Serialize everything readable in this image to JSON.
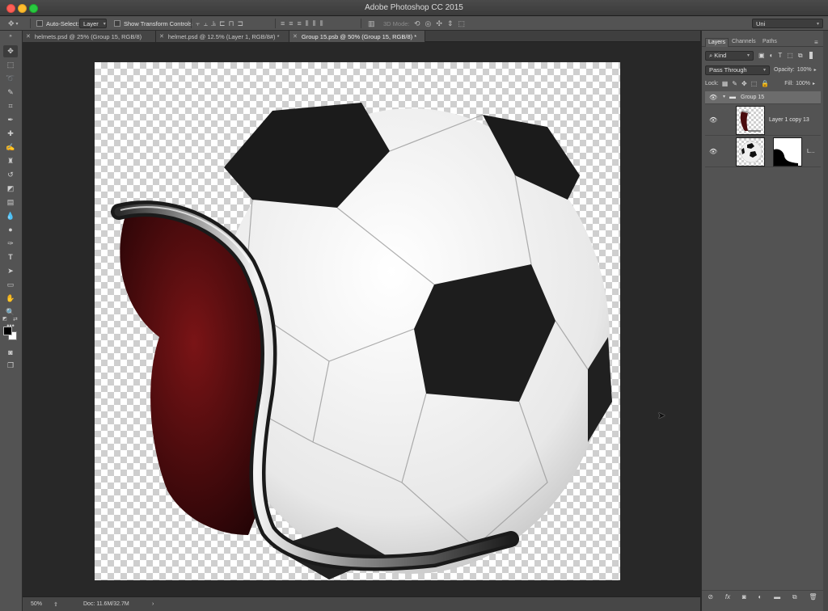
{
  "window": {
    "title": "Adobe Photoshop CC 2015"
  },
  "options_bar": {
    "auto_select_label": "Auto-Select:",
    "auto_select_value": "Layer",
    "show_transform_label": "Show Transform Controls",
    "mode_3d_label": "3D Mode:",
    "workspace_value": "Uni"
  },
  "tabs": [
    {
      "label": "helmets.psd @ 25% (Group 15, RGB/8)",
      "active": false
    },
    {
      "label": "helmet.psd @ 12.5% (Layer 1, RGB/8#) *",
      "active": false
    },
    {
      "label": "Group 15.psb @ 50% (Group 15, RGB/8) *",
      "active": true
    }
  ],
  "tools": [
    "move-icon",
    "marquee-icon",
    "lasso-icon",
    "quick-select-icon",
    "crop-icon",
    "eyedropper-icon",
    "healing-icon",
    "brush-icon",
    "stamp-icon",
    "history-brush-icon",
    "eraser-icon",
    "gradient-icon",
    "blur-icon",
    "dodge-icon",
    "pen-icon",
    "type-icon",
    "path-select-icon",
    "rectangle-icon",
    "hand-icon",
    "zoom-icon",
    "more-tools-icon"
  ],
  "status": {
    "zoom": "50%",
    "doc": "Doc: 11.6M/32.7M"
  },
  "layers_panel": {
    "tabs": [
      "Layers",
      "Channels",
      "Paths"
    ],
    "filter_label": "Kind",
    "blend_mode": "Pass Through",
    "opacity_label": "Opacity:",
    "opacity_value": "100%",
    "lock_label": "Lock:",
    "fill_label": "Fill:",
    "fill_value": "100%",
    "layers": [
      {
        "name": "Group 15",
        "type": "group",
        "visible": true
      },
      {
        "name": "Layer 1 copy 13",
        "type": "layer",
        "visible": true
      },
      {
        "name": "L...",
        "type": "layer-masked",
        "visible": true
      }
    ]
  },
  "colors": {
    "panel": "#535353",
    "canvas_bg": "#282828",
    "accent": "#2c7fd6"
  }
}
